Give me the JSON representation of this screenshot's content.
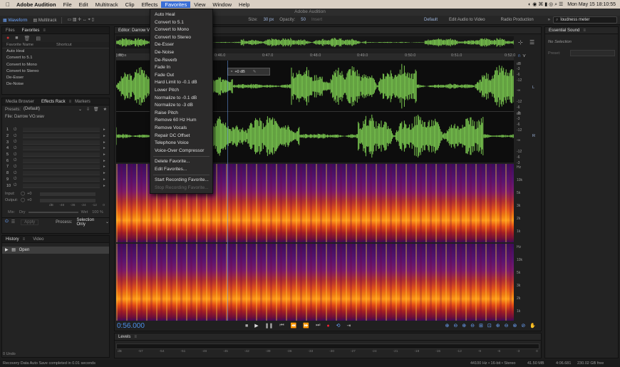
{
  "menubar": {
    "apple": "",
    "app": "Adobe Audition",
    "items": [
      "File",
      "Edit",
      "Multitrack",
      "Clip",
      "Effects",
      "Favorites",
      "View",
      "Window",
      "Help"
    ],
    "open_index": 5,
    "right_text": "Mon May 15 18:10:55"
  },
  "title": "Adobe Audition",
  "toolbar": {
    "waveform": "Waveform",
    "multitrack": "Multitrack",
    "size_label": "Size:",
    "size_value": "30 px",
    "opacity_label": "Opacity:",
    "opacity_value": "50",
    "insert": "Insert",
    "workspace": "Default",
    "edit_audio_video": "Edit Audio to Video",
    "radio_production": "Radio Production",
    "search_value": "loudness meter"
  },
  "favorites_panel": {
    "tabs": [
      "Files",
      "Favorites"
    ],
    "col_name": "Favorite Name",
    "col_shortcut": "Shortcut",
    "items": [
      "Auto Heal",
      "Convert to 5.1",
      "Convert to Mono",
      "Convert to Stereo",
      "De-Esser",
      "De-Noise"
    ]
  },
  "effects_rack": {
    "tabs": [
      "Media Browser",
      "Effects Rack",
      "Markers"
    ],
    "presets_label": "Presets:",
    "presets_value": "(Default)",
    "file_label": "File: Darrow VO.wav",
    "slots": [
      "1",
      "2",
      "3",
      "4",
      "5",
      "6",
      "7",
      "8",
      "9",
      "10"
    ],
    "input_label": "Input:",
    "input_value": "+0",
    "output_label": "Output:",
    "output_value": "+0",
    "meter_ticks": [
      "dB",
      "-48",
      "-36",
      "-24",
      "-12",
      "0"
    ],
    "mix_label": "Mix:",
    "dry": "Dry",
    "wet": "Wet",
    "mix_pct": "100 %",
    "apply": "Apply",
    "process_label": "Process:",
    "process_value": "Selection Only"
  },
  "history": {
    "tabs": [
      "History",
      "Video"
    ],
    "items": [
      "Open"
    ],
    "undo": "0 Undo"
  },
  "editor": {
    "tab": "Editor: Darrow VO.wav",
    "ruler": [
      "hms",
      "0:45.0",
      "0:46.0",
      "0:47.0",
      "0:48.0",
      "0:49.0",
      "0:50.0",
      "0:51.0",
      "0:52.0",
      "[dB]"
    ],
    "hud_value": "+0 dB",
    "db_top": [
      "dB",
      "-3",
      "-6",
      "-12",
      "-∞",
      "-12",
      "-6",
      "-3"
    ],
    "db_bot": [
      "dB",
      "-3",
      "-6",
      "-12",
      "-∞",
      "-12",
      "-6",
      "-3"
    ],
    "channel_l": "L",
    "channel_r": "R",
    "hz_top": [
      "Hz",
      "10k",
      "5k",
      "3k",
      "2k",
      "1k"
    ],
    "hz_bot": [
      "Hz",
      "10k",
      "5k",
      "3k",
      "2k",
      "1k"
    ],
    "time": "0:56.000"
  },
  "levels": {
    "title": "Levels",
    "scale": [
      "dB",
      "-57",
      "-54",
      "-51",
      "-48",
      "-45",
      "-42",
      "-39",
      "-36",
      "-33",
      "-30",
      "-27",
      "-24",
      "-21",
      "-18",
      "-15",
      "-12",
      "-9",
      "-6",
      "-3",
      "0"
    ]
  },
  "essential_sound": {
    "title": "Essential Sound",
    "no_selection": "No Selection",
    "preset_label": "Preset:"
  },
  "statusbar": {
    "left": "Recovery Data Auto Save completed in 0.01 seconds",
    "format": "44100 Hz • 16-bit • Stereo",
    "size": "41.50 MB",
    "duration": "4:06.681",
    "free": "230.02 GB free"
  },
  "dropdown": {
    "items": [
      "Auto Heal",
      "Convert to 5.1",
      "Convert to Mono",
      "Convert to Stereo",
      "De-Esser",
      "De-Noise",
      "De-Reverb",
      "Fade In",
      "Fade Out",
      "Hard Limit to -0.1 dB",
      "Lower Pitch",
      "Normalize to -0.1 dB",
      "Normalize to -3 dB",
      "Raise Pitch",
      "Remove 60 Hz Hum",
      "Remove Vocals",
      "Repair DC Offset",
      "Telephone Voice",
      "Voice-Over Compressor"
    ],
    "actions": [
      "Delete Favorite...",
      "Edit Favorites..."
    ],
    "recording": [
      "Start Recording Favorite...",
      "Stop Recording Favorite..."
    ]
  },
  "colors": {
    "waveform": "#7ac74f",
    "accent": "#3a6fd8",
    "time": "#4d8fe8"
  }
}
